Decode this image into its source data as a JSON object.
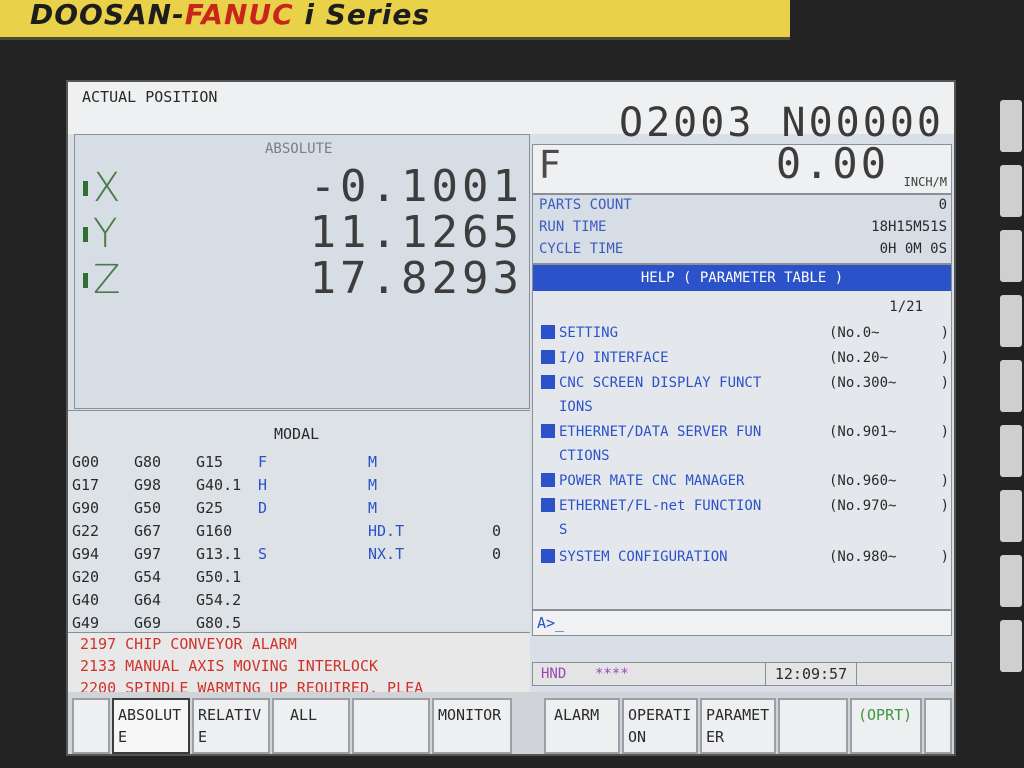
{
  "bezel": {
    "brand_doosan": "DOOSAN",
    "brand_dash": "-",
    "brand_fanuc": "FANUC",
    "brand_i": "i",
    "brand_series": "Series"
  },
  "header": {
    "title": "ACTUAL POSITION",
    "program": "O2003 N00000"
  },
  "position": {
    "label": "ABSOLUTE",
    "axes": [
      {
        "name": "X",
        "value": "-0.1001"
      },
      {
        "name": "Y",
        "value": "11.1265"
      },
      {
        "name": "Z",
        "value": "17.8293"
      }
    ]
  },
  "feed": {
    "label": "F",
    "value": "0.00",
    "unit": "INCH/M"
  },
  "status": {
    "parts_count_label": "PARTS COUNT",
    "parts_count": "0",
    "run_time_label": "RUN TIME",
    "run_time": "18H15M51S",
    "cycle_time_label": "CYCLE TIME",
    "cycle_time": "0H 0M 0S"
  },
  "help": {
    "title": "HELP ( PARAMETER TABLE )",
    "page": "1/21",
    "items": [
      {
        "name": "SETTING",
        "num": "(No.0~",
        "paren": ")"
      },
      {
        "name": "I/O INTERFACE",
        "num": "(No.20~",
        "paren": ")"
      },
      {
        "name": "CNC SCREEN DISPLAY FUNCT\nIONS",
        "num": "(No.300~",
        "paren": ")"
      },
      {
        "name": "ETHERNET/DATA SERVER FUN\nCTIONS",
        "num": "(No.901~",
        "paren": ")"
      },
      {
        "name": "POWER MATE CNC MANAGER",
        "num": "(No.960~",
        "paren": ")"
      },
      {
        "name": "ETHERNET/FL-net FUNCTION\nS",
        "num": "(No.970~",
        "paren": ")"
      },
      {
        "name": "SYSTEM CONFIGURATION",
        "num": "(No.980~",
        "paren": ")"
      }
    ]
  },
  "modal": {
    "title": "MODAL",
    "rows": [
      [
        "G00",
        "G80",
        "G15",
        "F",
        "M",
        ""
      ],
      [
        "G17",
        "G98",
        "G40.1",
        "H",
        "M",
        ""
      ],
      [
        "G90",
        "G50",
        "G25",
        "D",
        "M",
        ""
      ],
      [
        "G22",
        "G67",
        "G160",
        "",
        "HD.T",
        "0"
      ],
      [
        "G94",
        "G97",
        "G13.1",
        "S",
        "NX.T",
        "0"
      ],
      [
        "G20",
        "G54",
        "G50.1",
        "",
        "",
        ""
      ],
      [
        "G40",
        "G64",
        "G54.2",
        "",
        "",
        ""
      ],
      [
        "G49",
        "G69",
        "G80.5",
        "",
        "",
        ""
      ]
    ]
  },
  "alarms": [
    "2197 CHIP CONVEYOR ALARM",
    "2133 MANUAL AXIS MOVING INTERLOCK",
    "2200 SPINDLE WARMING UP REQUIRED. PLEA"
  ],
  "input": {
    "prompt": "A>_"
  },
  "statusbar": {
    "mode": "HND",
    "stars": "****",
    "clock": "12:09:57"
  },
  "softkeys": {
    "absolute": "ABSOLUTE",
    "relative": "RELATIVE",
    "all": "ALL",
    "monitor": "MONITOR",
    "alarm": "ALARM",
    "operation": "OPERATION",
    "parameter": "PARAMETER",
    "oprt": "(OPRT)"
  },
  "colors": {
    "accent_blue": "#2c52c9",
    "alarm_red": "#d0322a",
    "axis_green": "#4b7b4b",
    "brand_yellow": "#e9d24a"
  }
}
